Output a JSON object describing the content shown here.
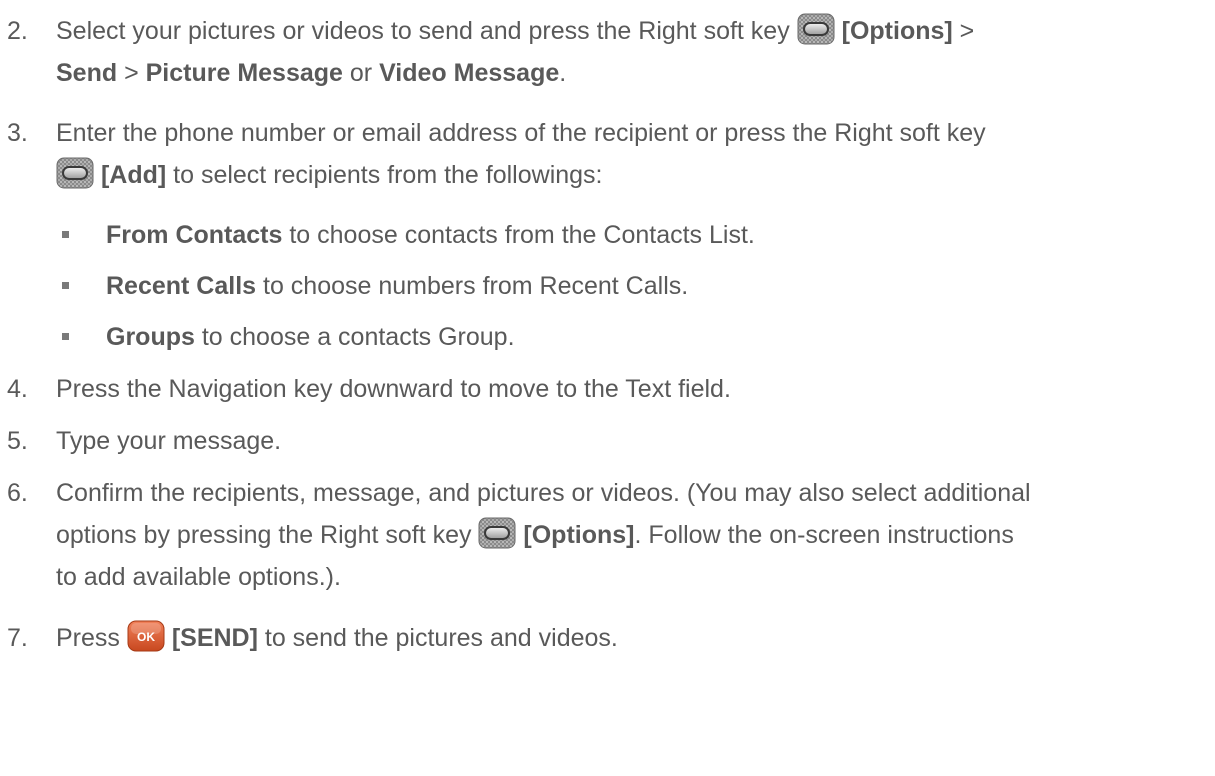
{
  "steps": {
    "s2": {
      "number": "2.",
      "line1_pre": "Select your pictures or videos to send and press the Right soft key ",
      "key_label": "[Options]",
      "line1_post": " >",
      "line2_send": "Send",
      "line2_sep": " > ",
      "line2_picture": "Picture Message",
      "line2_or": " or ",
      "line2_video": "Video Message",
      "line2_end": "."
    },
    "s3": {
      "number": "3.",
      "line1": "Enter the phone number or email address of the recipient or press the Right soft key",
      "key_label": "[Add]",
      "line2_post": " to select recipients from the followings:"
    },
    "bullets": [
      {
        "bold": "From Contacts",
        "text": " to choose contacts from the Contacts List."
      },
      {
        "bold": "Recent Calls",
        "text": " to choose numbers from Recent Calls."
      },
      {
        "bold": "Groups",
        "text": " to choose a contacts Group."
      }
    ],
    "s4": {
      "number": "4.",
      "text": "Press the Navigation key downward to move to the Text field."
    },
    "s5": {
      "number": "5.",
      "text": "Type your message."
    },
    "s6": {
      "number": "6.",
      "line1": "Confirm the recipients, message, and pictures or videos. (You may also select additional",
      "line2_pre": "options by pressing the Right soft key ",
      "key_label": "[Options]",
      "line2_post": ". Follow the on-screen instructions",
      "line3": "to add available options.)."
    },
    "s7": {
      "number": "7.",
      "pre": "Press ",
      "ok_icon_text": "OK",
      "key_label": "[SEND]",
      "post": " to send the pictures and videos."
    }
  },
  "icons": {
    "soft_key": "right-soft-key-icon",
    "ok_key": "ok-key-icon"
  },
  "colors": {
    "text": "#595959",
    "ok_key": "#d65a2e"
  }
}
